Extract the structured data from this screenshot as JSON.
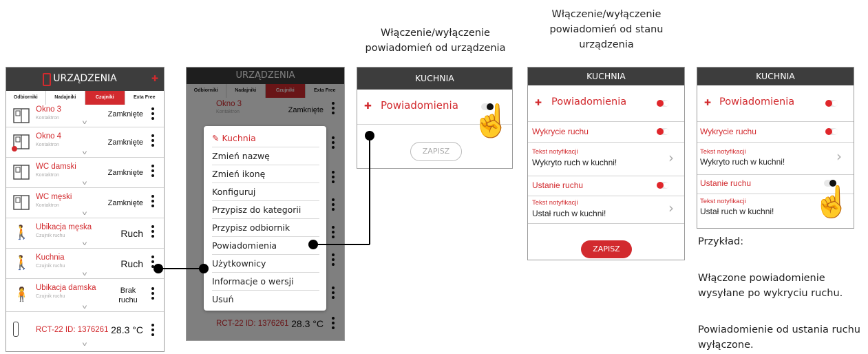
{
  "captions": {
    "device": "Włączenie/wyłączenie\npowiadomień od urządzenia",
    "state": "Włączenie/wyłączenie\npowiadomień od stanu\nurządzenia"
  },
  "phone1": {
    "title": "URZĄDZENIA",
    "tabs": [
      "Odbiorniki",
      "Nadajniki",
      "Czujniki",
      "Exta Free"
    ],
    "active_tab": "Czujniki",
    "rows": [
      {
        "name": "Okno 3",
        "sub": "Kontaktron",
        "state": "Zamknięte",
        "icon": "window-icon"
      },
      {
        "name": "Okno 4",
        "sub": "Kontaktron",
        "state": "Zamknięte",
        "icon": "window-icon"
      },
      {
        "name": "WC damski",
        "sub": "Kontaktron",
        "state": "Zamknięte",
        "icon": "window-icon"
      },
      {
        "name": "WC męski",
        "sub": "Kontaktron",
        "state": "Zamknięte",
        "icon": "window-icon"
      },
      {
        "name": "Ubikacja męska",
        "sub": "Czujnik ruchu",
        "state": "Ruch",
        "icon": "walking-person-icon"
      },
      {
        "name": "Kuchnia",
        "sub": "Czujnik ruchu",
        "state": "Ruch",
        "icon": "walking-person-icon"
      },
      {
        "name": "Ubikacja damska",
        "sub": "Czujnik ruchu",
        "state": "Brak ruchu",
        "icon": "standing-person-icon"
      },
      {
        "name": "RCT-22 ID: 1376261",
        "sub": "",
        "state": "28.3 °C",
        "icon": "thermometer-icon"
      }
    ]
  },
  "phone2": {
    "title": "URZĄDZENIA",
    "tabs": [
      "Odbiorniki",
      "Nadajniki",
      "Czujniki",
      "Exta Free"
    ],
    "bg_rows": [
      {
        "name": "Okno 3",
        "sub": "Kontaktron",
        "state": "Zamknięte"
      },
      {
        "name": "RCT-22 ID: 1376261",
        "state": "28.3 °C"
      }
    ],
    "menu_title": "Kuchnia",
    "menu_items": [
      "Zmień nazwę",
      "Zmień ikonę",
      "Konfiguruj",
      "Przypisz do kategorii",
      "Przypisz odbiornik",
      "Powiadomienia",
      "Użytkownicy",
      "Informacje o wersji",
      "Usuń"
    ]
  },
  "phone3": {
    "title": "KUCHNIA",
    "label": "Powiadomienia",
    "save": "ZAPISZ"
  },
  "phone4": {
    "title": "KUCHNIA",
    "label": "Powiadomienia",
    "motion": "Wykrycie ruchu",
    "text_label": "Tekst notyfikacji",
    "motion_text": "Wykryto ruch w kuchni!",
    "stop": "Ustanie ruchu",
    "stop_text": "Ustał ruch w kuchni!",
    "save": "ZAPISZ"
  },
  "phone5": {
    "title": "KUCHNIA",
    "label": "Powiadomienia",
    "motion": "Wykrycie ruchu",
    "text_label": "Tekst notyfikacji",
    "motion_text": "Wykryto ruch w kuchni!",
    "stop": "Ustanie ruchu",
    "stop_text": "Ustał ruch w kuchni!"
  },
  "example": {
    "title": "Przykład:",
    "p1": "Włączone powiadomienie wysyłane po wykryciu ruchu.",
    "p2": "Powiadomienie od ustania ruchu wyłączone."
  },
  "colors": {
    "accent": "#d22a2e",
    "header": "#3d3d3d"
  }
}
